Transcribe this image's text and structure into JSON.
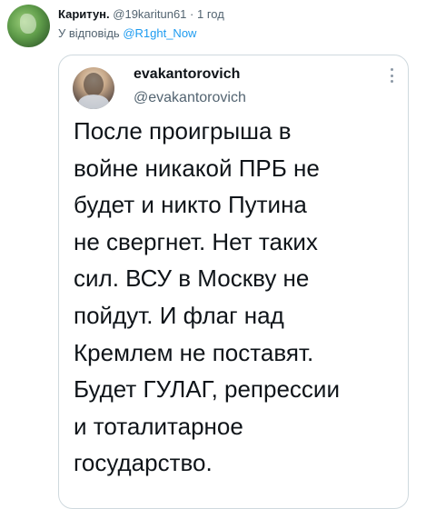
{
  "reply": {
    "author_name": "Каритун.",
    "author_handle": "@19karitun61",
    "separator": "·",
    "time": "1 год",
    "reply_to_label": "У відповідь",
    "reply_to_mention": "@R1ght_Now"
  },
  "quoted_tweet": {
    "author_name": "evakantorovich",
    "author_handle": "@evakantorovich",
    "text_lines": [
      "После проигрыша в",
      "войне никакой ПРБ не",
      "будет и никто Путина",
      "не свергнет. Нет таких",
      "сил. ВСУ в Москву не",
      "пойдут. И флаг над",
      "Кремлем не поставят.",
      "Будет ГУЛАГ, репрессии",
      "и тоталитарное",
      "государство."
    ]
  },
  "icons": {
    "reply_avatar": "avatar-image",
    "quoted_avatar": "avatar-image",
    "more": "more-options-icon"
  },
  "colors": {
    "link": "#1d9bf0",
    "secondary_text": "#536471",
    "border": "#cfd9de"
  }
}
